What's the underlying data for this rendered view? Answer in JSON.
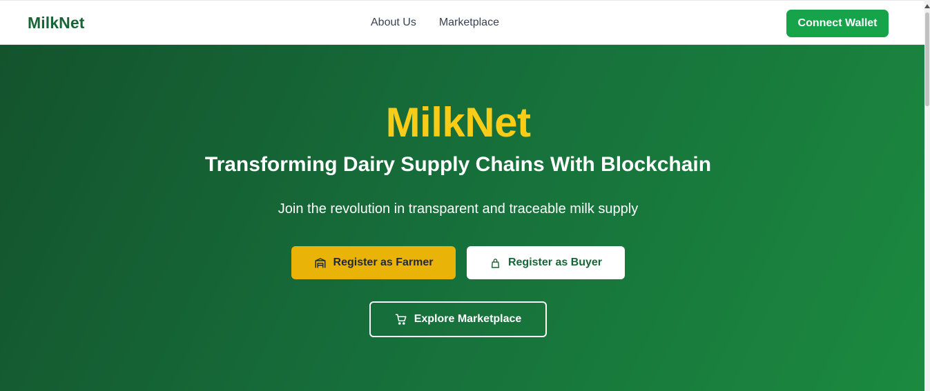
{
  "navbar": {
    "brand": "MilkNet",
    "links": [
      "About Us",
      "Marketplace"
    ],
    "connect_label": "Connect Wallet"
  },
  "hero": {
    "title": "MilkNet",
    "subtitle": "Transforming Dairy Supply Chains With Blockchain",
    "tagline": "Join the revolution in transparent and traceable milk supply",
    "buttons": {
      "farmer": {
        "label": "Register as Farmer",
        "icon": "warehouse-icon"
      },
      "buyer": {
        "label": "Register as Buyer",
        "icon": "shopping-bag-icon"
      },
      "explore": {
        "label": "Explore Marketplace",
        "icon": "shopping-cart-icon"
      }
    }
  },
  "colors": {
    "brand_green": "#166534",
    "accent_green": "#16a34a",
    "accent_yellow": "#facc15",
    "button_yellow": "#eab308"
  }
}
